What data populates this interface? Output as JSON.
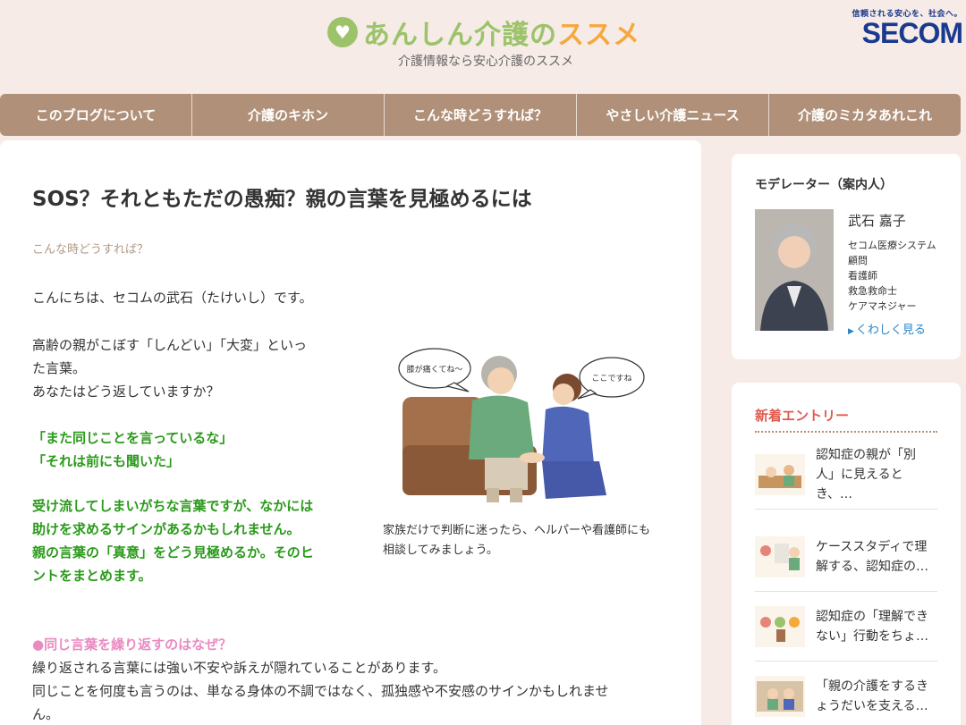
{
  "header": {
    "logo_main": "あんしん介護の",
    "logo_accent": "ススメ",
    "tagline": "介護情報なら安心介護のススメ",
    "secom_tagline": "信頼される安心を、社会へ。",
    "secom_logo": "SECOM"
  },
  "nav": {
    "items": [
      {
        "label": "このブログについて"
      },
      {
        "label": "介護のキホン"
      },
      {
        "label": "こんな時どうすれば？"
      },
      {
        "label": "やさしい介護ニュース"
      },
      {
        "label": "介護のミカタあれこれ"
      }
    ]
  },
  "article": {
    "title": "SOS？それともただの愚痴？親の言葉を見極めるには",
    "category": "こんな時どうすれば？",
    "greeting": "こんにちは、セコムの武石（たけいし）です。",
    "intro": [
      "高齢の親がこぼす「しんどい」「大変」といっ",
      "た言葉。",
      "あなたはどう返していますか？"
    ],
    "quotes": [
      "「また同じことを言っているな」",
      "「それは前にも聞いた」"
    ],
    "emphasis": [
      "受け流してしまいがちな言葉ですが、なかには",
      "助けを求めるサインがあるかもしれません。",
      "親の言葉の「真意」をどう見極めるか。そのヒ",
      "ントをまとめます。"
    ],
    "section_heading": "●同じ言葉を繰り返すのはなぜ？",
    "body": [
      "繰り返される言葉には強い不安や訴えが隠れていることがあります。",
      "同じことを何度も言うのは、単なる身体の不調ではなく、孤独感や不安感のサインかもしれませ",
      "ん。"
    ],
    "illustration": {
      "bubble_left": "膝が痛くてね〜",
      "bubble_right": "ここですね",
      "caption": [
        "家族だけで判断に迷ったら、ヘルパーや看護師にも",
        "相談してみましょう。"
      ]
    }
  },
  "sidebar": {
    "moderator": {
      "title": "モデレーター（案内人）",
      "name": "武石 嘉子",
      "roles": [
        "セコム医療システム",
        "顧問",
        "看護師",
        "救急救命士",
        "ケアマネジャー"
      ],
      "link": "くわしく見る"
    },
    "new_entries": {
      "title": "新着エントリー",
      "items": [
        {
          "title": [
            "認知症の親が「別",
            "人」に見えると",
            "き、…"
          ]
        },
        {
          "title": [
            "ケーススタディで理",
            "解する、認知症の…"
          ]
        },
        {
          "title": [
            "認知症の「理解でき",
            "ない」行動をちょ…"
          ]
        },
        {
          "title": [
            "「親の介護をするき",
            "ょうだいを支える…"
          ]
        }
      ]
    }
  },
  "colors": {
    "background": "#f6ebe6",
    "nav": "#b09078",
    "logo_green": "#9cc36a",
    "logo_orange": "#f5a93c",
    "green_text": "#2a9a1a",
    "pink_heading": "#e98ac1",
    "new_entries_red": "#e05a4f",
    "secom_blue": "#1a3a8f"
  }
}
